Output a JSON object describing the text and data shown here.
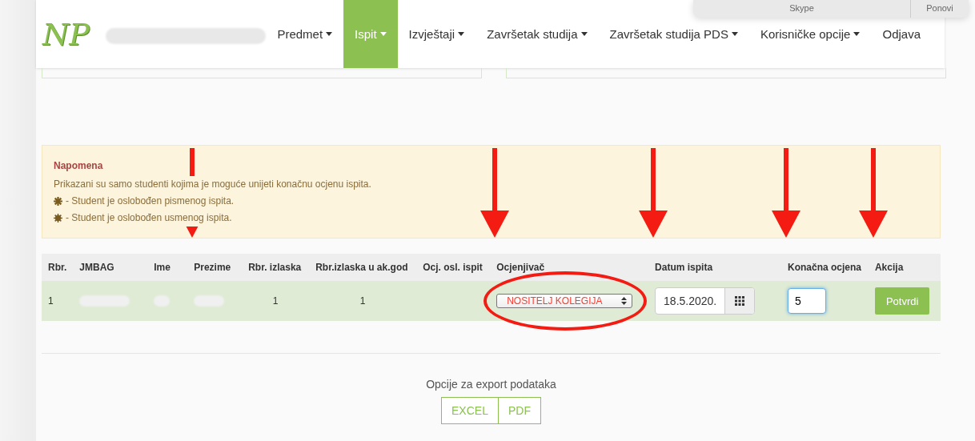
{
  "notification": {
    "app": "Skype",
    "action": "Ponovi"
  },
  "header": {
    "logo": "NP",
    "nav": [
      {
        "label": "Predmet",
        "dropdown": true,
        "selected": false
      },
      {
        "label": "Ispit",
        "dropdown": true,
        "selected": true
      },
      {
        "label": "Izvještaji",
        "dropdown": true,
        "selected": false
      },
      {
        "label": "Završetak studija",
        "dropdown": true,
        "selected": false
      },
      {
        "label": "Završetak studija PDS",
        "dropdown": true,
        "selected": false
      },
      {
        "label": "Korisničke opcije",
        "dropdown": true,
        "selected": false
      },
      {
        "label": "Odjava",
        "dropdown": false,
        "selected": false
      }
    ]
  },
  "notice": {
    "title": "Napomena",
    "lines": [
      {
        "kind": "text",
        "text": "Prikazani su samo studenti kojima je moguće unijeti konačnu ocjenu ispita."
      },
      {
        "kind": "asterisk",
        "text": "- Student je oslobođen pismenog ispita."
      },
      {
        "kind": "sun",
        "text": "- Student je oslobođen usmenog ispita."
      }
    ]
  },
  "table": {
    "columns": [
      {
        "label": "Rbr.",
        "marked": false
      },
      {
        "label": "JMBAG",
        "marked": false
      },
      {
        "label": "Ime",
        "marked": false
      },
      {
        "label": "Prezime",
        "marked": true
      },
      {
        "label": "Rbr. izlaska",
        "marked": false
      },
      {
        "label": "Rbr.izlaska u ak.god",
        "marked": false
      },
      {
        "label": "Ocj. osl. ispit",
        "marked": false
      },
      {
        "label": "Ocjenjivač",
        "marked": true
      },
      {
        "label": "Datum ispita",
        "marked": true
      },
      {
        "label": "Konačna ocjena",
        "marked": true
      },
      {
        "label": "Akcija",
        "marked": true
      }
    ],
    "rows": [
      {
        "cells": [
          {
            "kind": "text",
            "text": "1"
          },
          {
            "kind": "blurred"
          },
          {
            "kind": "blurred"
          },
          {
            "kind": "blurred"
          },
          {
            "kind": "text",
            "text": "1"
          },
          {
            "kind": "text",
            "text": "1"
          },
          {
            "kind": "empty"
          },
          {
            "kind": "select",
            "value": "NOSITELJ KOLEGIJA",
            "circled": true
          },
          {
            "kind": "date",
            "value": "18.5.2020."
          },
          {
            "kind": "input",
            "value": "5",
            "focused": true
          },
          {
            "kind": "button",
            "label": "Potvrdi"
          }
        ]
      }
    ]
  },
  "export": {
    "title": "Opcije za export podataka",
    "buttons": [
      "EXCEL",
      "PDF"
    ]
  }
}
